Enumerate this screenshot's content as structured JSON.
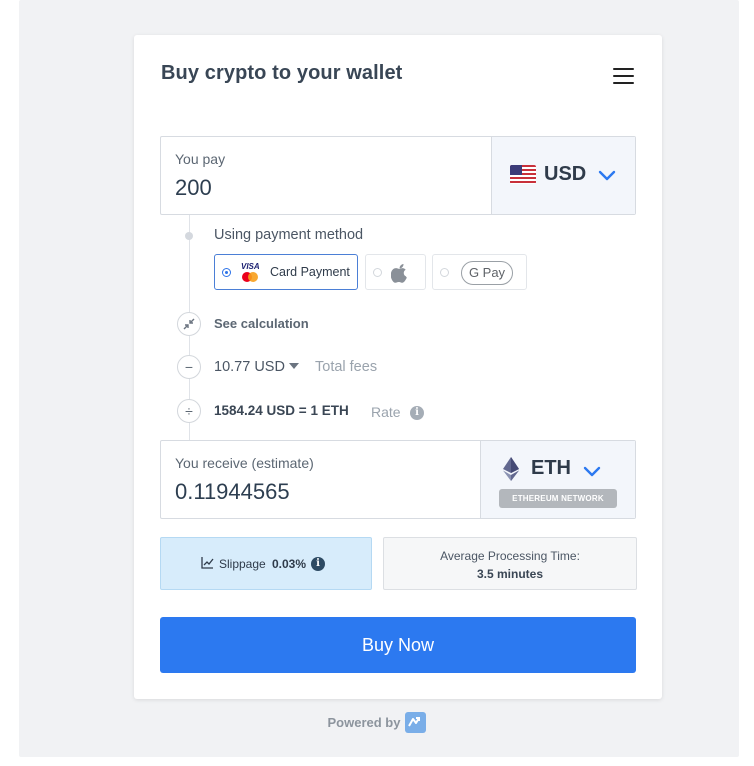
{
  "header": {
    "title": "Buy crypto to your wallet"
  },
  "pay": {
    "label": "You pay",
    "amount": "200",
    "currency": "USD"
  },
  "payment": {
    "label": "Using payment method",
    "options": [
      {
        "name": "Card Payment",
        "brands": [
          "VISA",
          "Mastercard"
        ],
        "selected": true
      },
      {
        "name": "Apple Pay",
        "selected": false
      },
      {
        "name": "Google Pay",
        "display": "G Pay",
        "selected": false
      }
    ]
  },
  "calc": {
    "see_label": "See calculation",
    "fees_value": "10.77 USD",
    "fees_label": "Total fees",
    "rate_value": "1584.24 USD = 1 ETH",
    "rate_label": "Rate"
  },
  "receive": {
    "label": "You receive (estimate)",
    "amount": "0.11944565",
    "currency": "ETH",
    "network": "ETHEREUM NETWORK"
  },
  "slippage": {
    "label": "Slippage",
    "value": "0.03%"
  },
  "processing": {
    "label": "Average Processing Time:",
    "value": "3.5 minutes"
  },
  "actions": {
    "buy_label": "Buy Now"
  },
  "footer": {
    "powered_by": "Powered by"
  },
  "colors": {
    "accent": "#2c79f0",
    "slippage_bg": "#d7ecfb"
  }
}
